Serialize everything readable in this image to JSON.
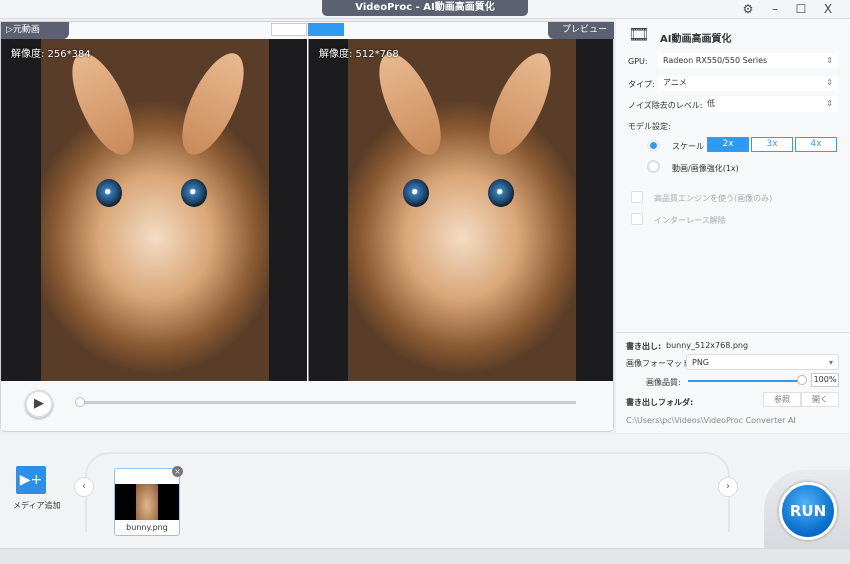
{
  "window": {
    "title": "VideoProc - AI動画高画質化",
    "settings_icon": "gear-icon",
    "minimize": "–",
    "maximize": "☐",
    "close": "X"
  },
  "preview": {
    "source_tab": "▷元動画",
    "preview_tab": "プレビュー",
    "left_resolution": "解像度: 256*384",
    "right_resolution": "解像度: 512*768",
    "seek_progress": 0
  },
  "panel": {
    "title": "AI動画高画質化",
    "gpu_label": "GPU:",
    "gpu_value": "Radeon RX550/550 Series",
    "type_label": "タイプ:",
    "type_value": "アニメ",
    "noise_label": "ノイズ除去のレベル:",
    "noise_value": "低",
    "model_label": "モデル設定:",
    "scale_label": "スケール",
    "scale_options": [
      "2x",
      "3x",
      "4x"
    ],
    "scale_selected": "2x",
    "enhance_label": "動画/画像強化(1x)",
    "hq_engine_label": "高品質エンジンを使う(画像のみ)",
    "deinterlace_label": "インターレース解除",
    "export_label": "書き出し:",
    "export_value": "bunny_512x768.png",
    "format_label": "画像フォーマット:",
    "format_value": "PNG",
    "quality_label": "画像品質:",
    "quality_value": "100%",
    "quality_percent": 100,
    "folder_label": "書き出しフォルダ:",
    "browse": "参照",
    "open": "開く",
    "folder_path": "C:\\Users\\pc\\Videos\\VideoProc Converter AI"
  },
  "media": {
    "add_label": "メディア追加",
    "items": [
      {
        "name": "bunny.png"
      }
    ]
  },
  "run_label": "RUN",
  "colors": {
    "accent": "#3a9be8",
    "titlebar": "#5b6170"
  }
}
